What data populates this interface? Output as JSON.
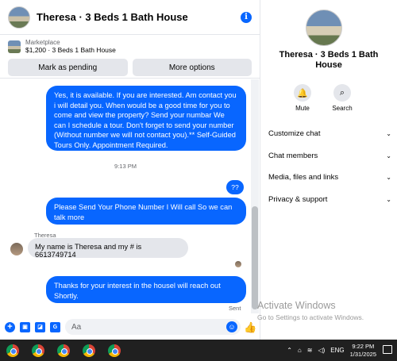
{
  "chat": {
    "title": "Theresa · 3 Beds 1 Bath House",
    "marketplace": {
      "label": "Marketplace",
      "listing": "$1,200 · 3 Beds 1 Bath House",
      "buttons": [
        "Mark as pending",
        "More options"
      ]
    },
    "messages": [
      {
        "type": "outgoing",
        "text": "Yes, it is available. If you are interested.  Am contact you i will detail you.  When would be a good time for you to come and view the property? Send your numbar We can I schedule a tour.  Don't forget to send your number (Without number we will not contact you).** Self-Guided Tours Only. Appointment Required."
      },
      {
        "type": "timestamp",
        "text": "9:13 PM"
      },
      {
        "type": "outgoing",
        "text": "??"
      },
      {
        "type": "outgoing",
        "text": "Please Send Your Phone Number I Will call So we can talk more"
      },
      {
        "type": "incoming",
        "sender": "Theresa",
        "text": "My name is Theresa and my # is 6613749714"
      },
      {
        "type": "outgoing",
        "text": "Thanks for your interest in the housel will reach out Shortly."
      }
    ],
    "status": "Sent",
    "composer": {
      "placeholder": "Aa"
    }
  },
  "details": {
    "title": "Theresa · 3 Beds 1 Bath House",
    "actions": [
      "Mute",
      "Search"
    ],
    "menu": [
      "Customize chat",
      "Chat members",
      "Media, files and links",
      "Privacy & support"
    ]
  },
  "watermark": {
    "line1": "Activate Windows",
    "line2": "Go to Settings to activate Windows."
  },
  "taskbar": {
    "language": "ENG",
    "time": "9:22 PM",
    "date": "1/31/2025"
  },
  "colors": {
    "accent": "#0866ff",
    "bubble_in": "#e4e6eb",
    "taskbar": "#202020"
  }
}
